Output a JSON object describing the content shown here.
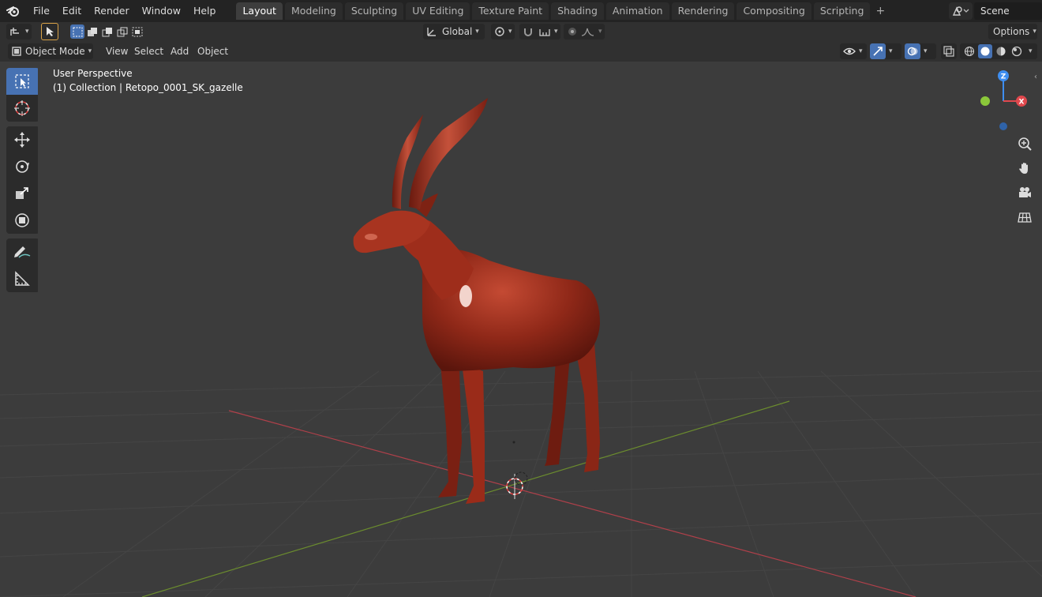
{
  "app": {
    "menu": [
      "File",
      "Edit",
      "Render",
      "Window",
      "Help"
    ]
  },
  "workspaces": [
    {
      "label": "Layout",
      "active": true
    },
    {
      "label": "Modeling",
      "active": false
    },
    {
      "label": "Sculpting",
      "active": false
    },
    {
      "label": "UV Editing",
      "active": false
    },
    {
      "label": "Texture Paint",
      "active": false
    },
    {
      "label": "Shading",
      "active": false
    },
    {
      "label": "Animation",
      "active": false
    },
    {
      "label": "Rendering",
      "active": false
    },
    {
      "label": "Compositing",
      "active": false
    },
    {
      "label": "Scripting",
      "active": false
    }
  ],
  "scene": {
    "name": "Scene"
  },
  "header": {
    "orientation": "Global",
    "options": "Options",
    "mode": "Object Mode",
    "view": "View",
    "select": "Select",
    "add": "Add",
    "object": "Object"
  },
  "viewport": {
    "perspective": "User Perspective",
    "collection": "(1) Collection | Retopo_0001_SK_gazelle"
  },
  "colors": {
    "accent": "#4772b3",
    "axis_x": "#e0484d",
    "axis_y": "#8bc83a",
    "axis_z": "#3e8ef0",
    "model": "#9a2a18"
  },
  "icons": {
    "tools": [
      "select-box-icon",
      "cursor-icon",
      "move-icon",
      "rotate-icon",
      "scale-icon",
      "transform-icon",
      "annotate-icon",
      "measure-icon"
    ],
    "nav": [
      "zoom-icon",
      "pan-hand-icon",
      "camera-icon",
      "grid-ortho-icon"
    ]
  }
}
